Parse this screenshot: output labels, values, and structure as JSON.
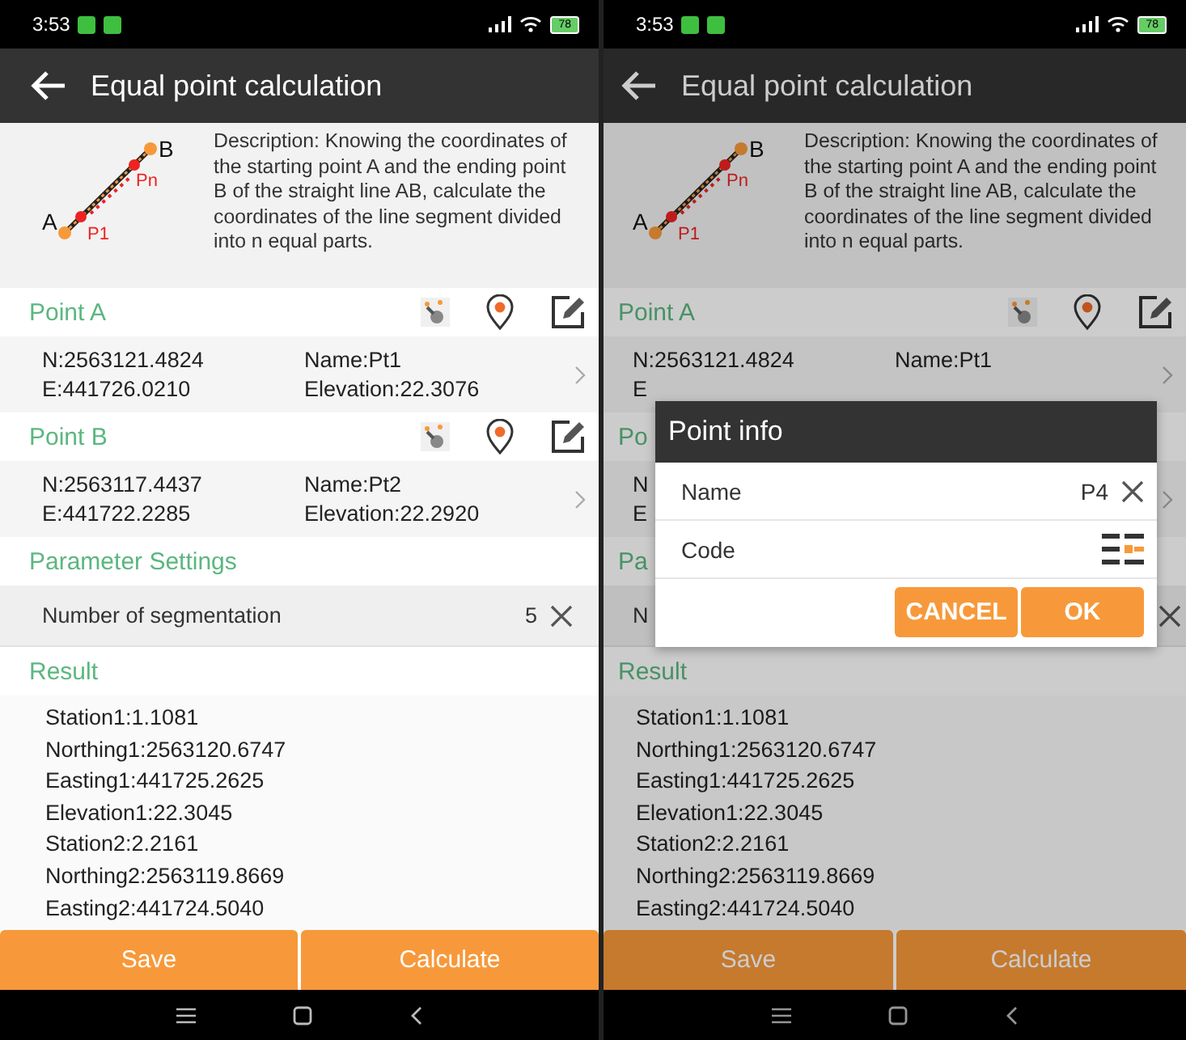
{
  "screens": [
    {
      "dimmed": false,
      "status_bar": {
        "time": "3:53",
        "battery": "78"
      },
      "app_bar": {
        "title": "Equal point calculation"
      },
      "description": {
        "text": "Description: Knowing the coordinates of the starting point A and the ending point B of the straight line AB, calculate the coordinates of the line segment divided into n equal parts.",
        "diagram_labels": [
          "A",
          "B",
          "P1",
          "Pn"
        ]
      },
      "points": [
        {
          "label": "Point A",
          "tools": true,
          "lines": [
            [
              "N:2563121.4824",
              "Name:Pt1"
            ],
            [
              "E:441726.0210",
              "Elevation:22.3076"
            ]
          ]
        },
        {
          "label": "Point B",
          "tools": true,
          "lines": [
            [
              "N:2563117.4437",
              "Name:Pt2"
            ],
            [
              "E:441722.2285",
              "Elevation:22.2920"
            ]
          ]
        }
      ],
      "parameters": {
        "heading": "Parameter Settings",
        "rows": [
          {
            "label": "Number of segmentation",
            "value": "5"
          }
        ]
      },
      "result": {
        "heading": "Result",
        "lines": [
          "Station1:1.1081",
          "Northing1:2563120.6747",
          "Easting1:441725.2625",
          "Elevation1:22.3045",
          "Station2:2.2161",
          "Northing2:2563119.8669",
          "Easting2:441724.5040"
        ]
      },
      "buttons": [
        "Save",
        "Calculate"
      ]
    },
    {
      "dimmed": true,
      "status_bar": {
        "time": "3:53",
        "battery": "78"
      },
      "app_bar": {
        "title": "Equal point calculation"
      },
      "description": {
        "text": "Description: Knowing the coordinates of the starting point A and the ending point B of the straight line AB, calculate the coordinates of the line segment divided into n equal parts.",
        "diagram_labels": [
          "A",
          "B",
          "P1",
          "Pn"
        ]
      },
      "points": [
        {
          "label": "Point A",
          "tools": true,
          "lines": [
            [
              "N:2563121.4824",
              "Name:Pt1"
            ],
            [
              "E"
            ]
          ]
        },
        {
          "label": "Po",
          "tools": false,
          "lines": [
            [
              "N"
            ],
            [
              "E"
            ]
          ]
        }
      ],
      "parameters": {
        "heading": "Pa",
        "rows": [
          {
            "label": "N"
          }
        ]
      },
      "result": {
        "heading": "Result",
        "lines": [
          "Station1:1.1081",
          "Northing1:2563120.6747",
          "Easting1:441725.2625",
          "Elevation1:22.3045",
          "Station2:2.2161",
          "Northing2:2563119.8669",
          "Easting2:441724.5040"
        ]
      },
      "buttons": [
        "Save",
        "Calculate"
      ],
      "dialog": {
        "title": "Point info",
        "fields": [
          {
            "kind": "text",
            "label": "Name",
            "value": "P4"
          },
          {
            "kind": "code",
            "label": "Code"
          }
        ],
        "buttons": [
          "CANCEL",
          "OK"
        ]
      }
    }
  ]
}
